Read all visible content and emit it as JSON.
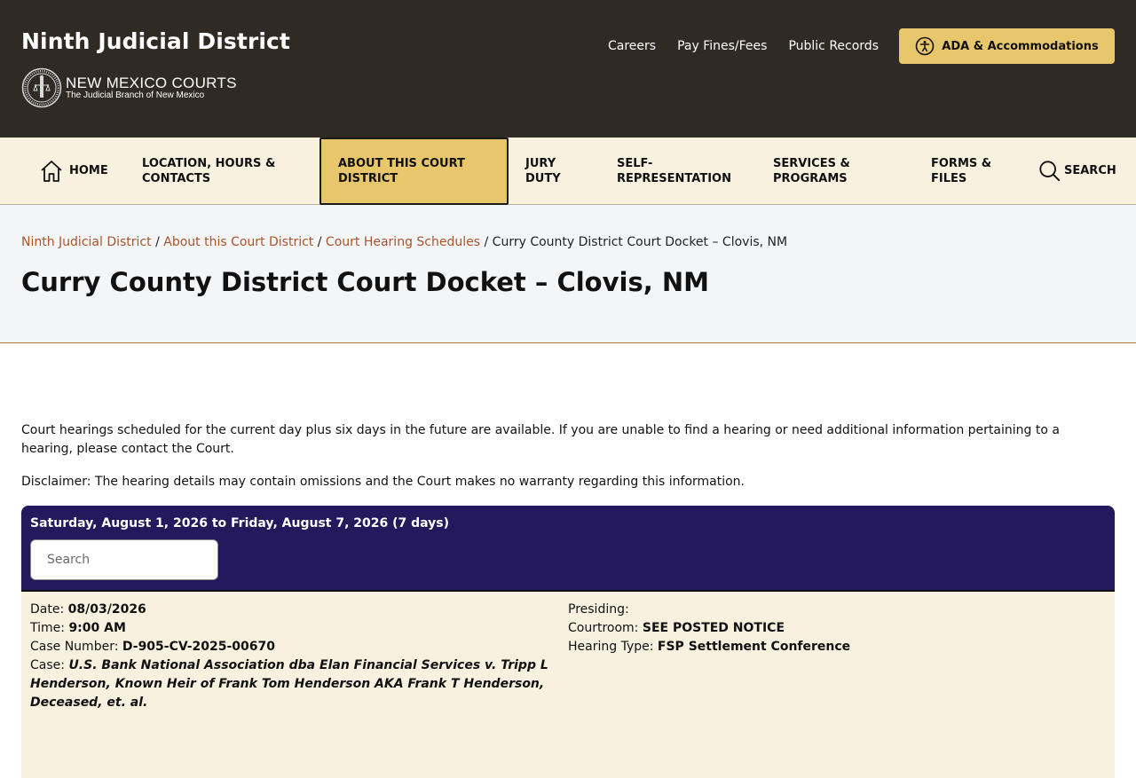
{
  "header": {
    "site_title": "Ninth Judicial District",
    "logo_main": "NEW MEXICO COURTS",
    "logo_sub": "The Judicial Branch of New Mexico",
    "links": [
      "Careers",
      "Pay Fines/Fees",
      "Public Records"
    ],
    "ada_label": "ADA & Accommodations",
    "accent_color": "#e8c66b",
    "bg_color": "#302a25"
  },
  "nav": {
    "home": "HOME",
    "location": "LOCATION, HOURS & CONTACTS",
    "about": "ABOUT THIS COURT DISTRICT",
    "jury": "JURY DUTY",
    "self_rep": "SELF-REPRESENTATION",
    "services": "SERVICES & PROGRAMS",
    "forms": "FORMS & FILES",
    "search": "SEARCH",
    "active": "about"
  },
  "breadcrumb": {
    "items": [
      "Ninth Judicial District",
      "About this Court District",
      "Court Hearing Schedules"
    ],
    "current": "Curry County District Court Docket – Clovis, NM",
    "separator": "/"
  },
  "page_title": "Curry County District Court Docket – Clovis, NM",
  "intro": "Court hearings scheduled for the current day plus six days in the future are available. If you are unable to find a hearing or need additional information pertaining to a hearing, please contact the Court.",
  "disclaimer": "Disclaimer:  The hearing details may contain omissions and the Court makes no warranty regarding this information.",
  "docket": {
    "range": "Saturday, August 1, 2026 to Friday, August 7, 2026 (7 days)",
    "search_placeholder": "Search",
    "search_value": "",
    "header_color": "#24195c",
    "hearings": [
      {
        "date_label": "Date:",
        "date": "08/03/2026",
        "time_label": "Time:",
        "time": "9:00 AM",
        "case_number_label": "Case Number:",
        "case_number": "D-905-CV-2025-00670",
        "case_label": "Case:",
        "case": "U.S. Bank National Association dba Elan Financial Services v. Tripp L Henderson, Known Heir of Frank Tom Henderson AKA Frank T Henderson, Deceased, et. al.",
        "presiding_label": "Presiding:",
        "presiding": "",
        "courtroom_label": "Courtroom:",
        "courtroom": "SEE POSTED NOTICE",
        "hearing_type_label": "Hearing Type:",
        "hearing_type": "FSP Settlement Conference"
      }
    ]
  }
}
